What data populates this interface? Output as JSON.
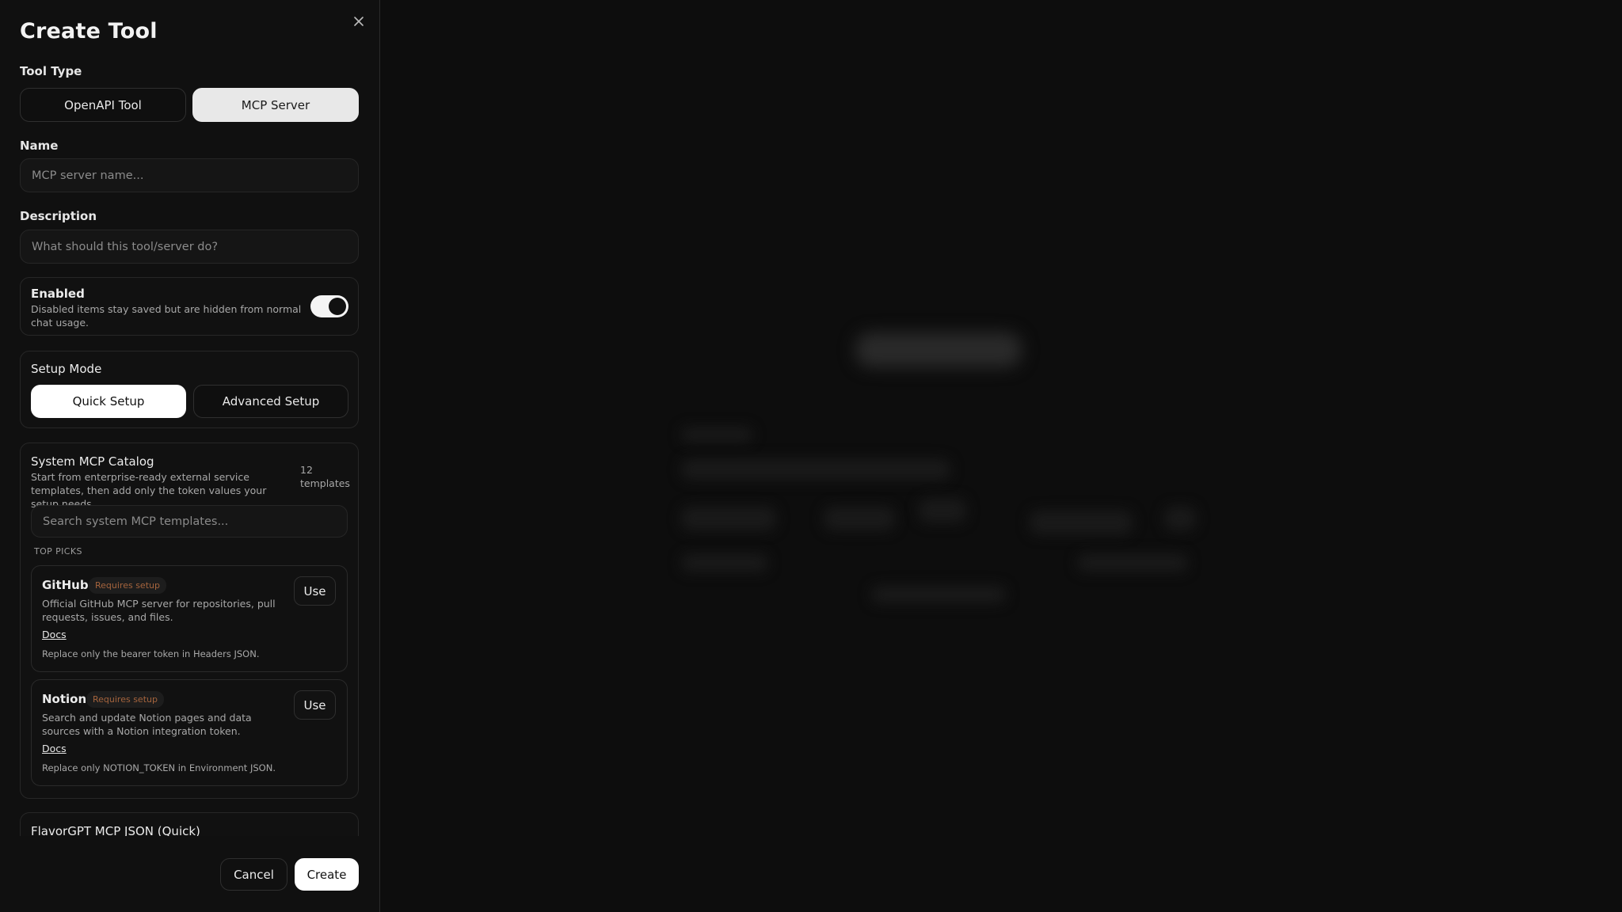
{
  "dialog": {
    "title": "Create Tool",
    "close_icon": "close-icon"
  },
  "tool_type": {
    "label": "Tool Type",
    "options": [
      "OpenAPI Tool",
      "MCP Server"
    ],
    "selected": "MCP Server"
  },
  "name": {
    "label": "Name",
    "placeholder": "MCP server name...",
    "value": ""
  },
  "description": {
    "label": "Description",
    "placeholder": "What should this tool/server do?",
    "value": ""
  },
  "enabled": {
    "label": "Enabled",
    "help": "Disabled items stay saved but are hidden from normal chat usage.",
    "on": true
  },
  "setup_mode": {
    "label": "Setup Mode",
    "options": [
      "Quick Setup",
      "Advanced Setup"
    ],
    "selected": "Quick Setup"
  },
  "catalog": {
    "title": "System MCP Catalog",
    "subtitle": "Start from enterprise-ready external service templates, then add only the token values your setup needs.",
    "count_number": "12",
    "count_label": "templates",
    "search_placeholder": "Search system MCP templates...",
    "section_label": "TOP PICKS",
    "templates": [
      {
        "name": "GitHub",
        "badge": "Requires setup",
        "description": "Official GitHub MCP server for repositories, pull requests, issues, and files.",
        "docs_label": "Docs",
        "note": "Replace only the bearer token in Headers JSON.",
        "use_label": "Use"
      },
      {
        "name": "Notion",
        "badge": "Requires setup",
        "description": "Search and update Notion pages and data sources with a Notion integration token.",
        "docs_label": "Docs",
        "note": "Replace only NOTION_TOKEN in Environment JSON.",
        "use_label": "Use"
      }
    ]
  },
  "quick_json": {
    "title": "FlavorGPT MCP JSON (Quick)"
  },
  "footer": {
    "cancel_label": "Cancel",
    "create_label": "Create"
  },
  "colors": {
    "panel_bg": "#101010",
    "accent_selected": "#e8e8e8",
    "badge_text": "#a5643d"
  }
}
